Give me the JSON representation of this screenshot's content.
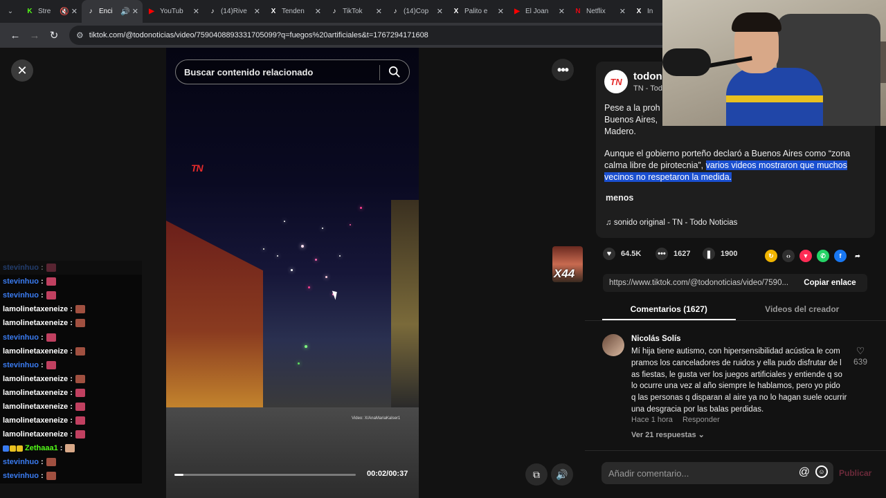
{
  "browser": {
    "tabs": [
      {
        "title": "Stre",
        "icon": "kick-icon",
        "color": "#53fc18",
        "glyph": "K",
        "active": false,
        "muted": true
      },
      {
        "title": "Enci",
        "icon": "tiktok-icon",
        "color": "#ffffff",
        "glyph": "♪",
        "active": true,
        "audio": true
      },
      {
        "title": "YouTub",
        "icon": "youtube-icon",
        "color": "#ff0000",
        "glyph": "▶",
        "active": false
      },
      {
        "title": "(14)Rive",
        "icon": "tiktok-icon",
        "color": "#ffffff",
        "glyph": "♪",
        "active": false
      },
      {
        "title": "Tenden",
        "icon": "x-icon",
        "color": "#ffffff",
        "glyph": "X",
        "active": false
      },
      {
        "title": "TikTok",
        "icon": "tiktok-icon",
        "color": "#ffffff",
        "glyph": "♪",
        "active": false
      },
      {
        "title": "(14)Cop",
        "icon": "tiktok-icon",
        "color": "#ffffff",
        "glyph": "♪",
        "active": false
      },
      {
        "title": "Palito e",
        "icon": "x-icon",
        "color": "#ffffff",
        "glyph": "X",
        "active": false
      },
      {
        "title": "El Joan",
        "icon": "youtube-icon",
        "color": "#ff0000",
        "glyph": "▶",
        "active": false
      },
      {
        "title": "Netflix",
        "icon": "netflix-icon",
        "color": "#e50914",
        "glyph": "N",
        "active": false
      },
      {
        "title": "In",
        "icon": "x-icon",
        "color": "#ffffff",
        "glyph": "X",
        "active": false
      }
    ],
    "url": "tiktok.com/@todonoticias/video/7590408893331705099?q=fuegos%20artificiales&t=1767294171608"
  },
  "player": {
    "search_placeholder": "Buscar contenido relacionado",
    "watermark": "TN",
    "credit": "Video: X/AnaMariaKalser1",
    "time": "00:02/00:37",
    "progress_fraction": 0.05
  },
  "chat": [
    {
      "user": "stevinhuo",
      "color": "#3a7bf0",
      "emote": "#c04060",
      "faded": true
    },
    {
      "user": "stevinhuo",
      "color": "#3a7bf0",
      "emote": "#c04060"
    },
    {
      "user": "stevinhuo",
      "color": "#3a7bf0",
      "emote": "#c04060"
    },
    {
      "user": "lamolinetaxeneize",
      "color": "#ffffff",
      "emote": "#a05040"
    },
    {
      "user": "lamolinetaxeneize",
      "color": "#ffffff",
      "emote": "#a05040"
    },
    {
      "user": "stevinhuo",
      "color": "#3a7bf0",
      "emote": "#c04060"
    },
    {
      "user": "lamolinetaxeneize",
      "color": "#ffffff",
      "emote": "#a05040"
    },
    {
      "user": "stevinhuo",
      "color": "#3a7bf0",
      "emote": "#c04060"
    },
    {
      "user": "lamolinetaxeneize",
      "color": "#ffffff",
      "emote": "#a05040"
    },
    {
      "user": "lamolinetaxeneize",
      "color": "#ffffff",
      "emote": "#c04060"
    },
    {
      "user": "lamolinetaxeneize",
      "color": "#ffffff",
      "emote": "#c04060"
    },
    {
      "user": "lamolinetaxeneize",
      "color": "#ffffff",
      "emote": "#c04060"
    },
    {
      "user": "lamolinetaxeneize",
      "color": "#ffffff",
      "emote": "#c04060"
    },
    {
      "user": "Zethaaa1",
      "color": "#53fc18",
      "emote": "#d8a888",
      "badges": [
        "#3a7bf0",
        "#e8c020",
        "#e8c020"
      ]
    },
    {
      "user": "stevinhuo",
      "color": "#3a7bf0",
      "emote": "#a05040"
    },
    {
      "user": "stevinhuo",
      "color": "#3a7bf0",
      "emote": "#a05040"
    }
  ],
  "overlay_badge": "X44",
  "post": {
    "author": "todon",
    "author_sub": "TN - Tod",
    "avatar_text": "TN",
    "desc_lines": [
      "Pese a la proh",
      "Buenos Aires,",
      "Madero."
    ],
    "desc2_plain": "Aunque el gobierno porteño declaró a Buenos Aires como “zona calma libre de pirotecnia”, ",
    "desc2_highlight": "varios videos mostraron que muchos vecinos no respetaron la medida.",
    "less_label": "menos",
    "sound": "sonido original - TN - Todo Noticias"
  },
  "stats": {
    "likes": "64.5K",
    "comments": "1627",
    "saves": "1900"
  },
  "share_icons": [
    {
      "name": "repost-icon",
      "color": "#f0b400",
      "glyph": "↻"
    },
    {
      "name": "embed-icon",
      "color": "#2f2f2f",
      "glyph": "‹›"
    },
    {
      "name": "send-icon",
      "color": "#fe2c55",
      "glyph": "▼"
    },
    {
      "name": "whatsapp-icon",
      "color": "#25d366",
      "glyph": "✆"
    },
    {
      "name": "facebook-icon",
      "color": "#1877f2",
      "glyph": "f"
    },
    {
      "name": "share-arrow-icon",
      "color": "#121212",
      "glyph": "➦"
    }
  ],
  "link": {
    "url": "https://www.tiktok.com/@todonoticias/video/7590...",
    "copy_label": "Copiar enlace"
  },
  "tabs": {
    "comments": "Comentarios (1627)",
    "creator": "Videos del creador"
  },
  "comment": {
    "user": "Nicolás Solís",
    "lines": [
      "Mí hija tiene autismo, con hipersensibilidad acústica le com",
      "pramos los canceladores de ruidos y ella pudo disfrutar de l",
      "as fiestas, le gusta ver los juegos artificiales y entiende q so",
      "lo ocurre una vez al año siempre le hablamos, pero yo pido",
      "q las personas q disparan al aire ya no lo hagan suele ocurrir",
      "una desgracia por las balas perdidas."
    ],
    "time": "Hace 1 hora",
    "reply_label": "Responder",
    "likes": "639",
    "replies": "Ver 21 respuestas"
  },
  "add_comment": {
    "placeholder": "Añadir comentario...",
    "post_label": "Publicar"
  }
}
